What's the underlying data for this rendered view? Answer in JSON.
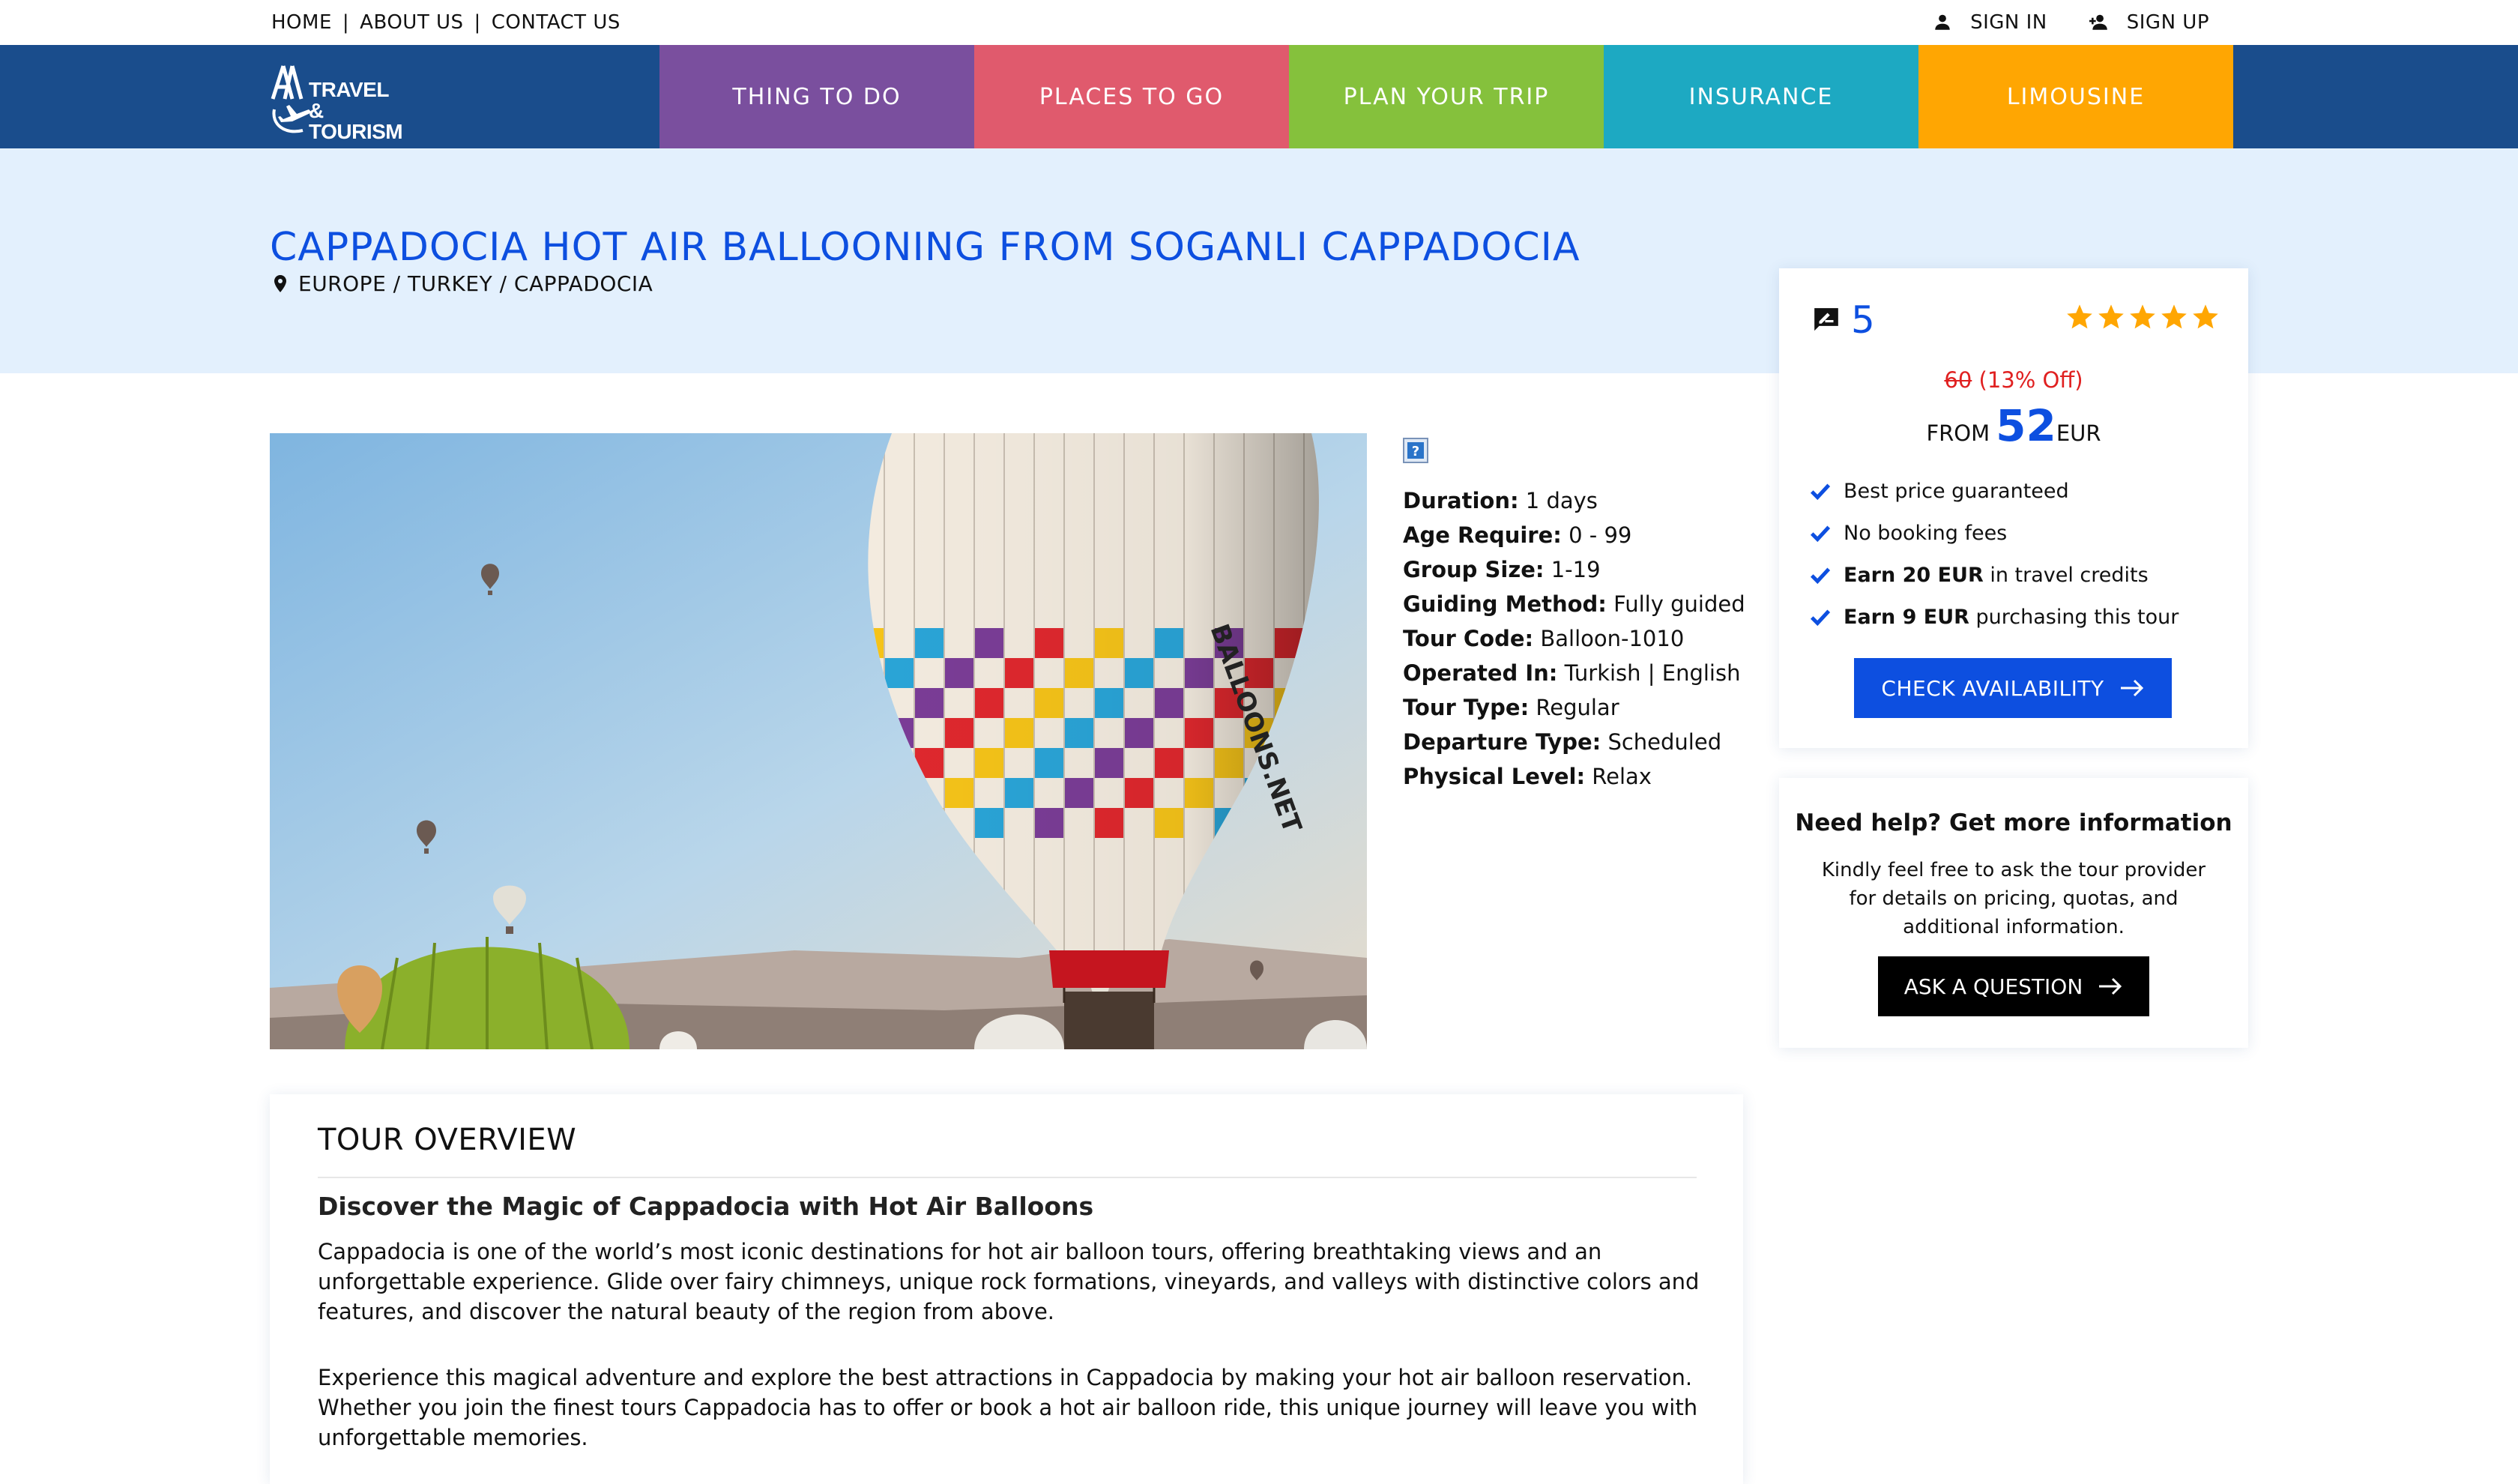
{
  "topbar": {
    "links": [
      "HOME",
      "ABOUT US",
      "CONTACT US"
    ],
    "sign_in": "SIGN IN",
    "sign_up": "SIGN UP"
  },
  "nav": {
    "logo_text": "TRAVEL & TOURISM",
    "logo_line1": "TRAVEL &",
    "logo_line2": "TOURISM",
    "items": [
      {
        "label": "THING TO DO",
        "color": "#7a4f9e"
      },
      {
        "label": "PLACES TO GO",
        "color": "#e05a6d"
      },
      {
        "label": "PLAN YOUR TRIP",
        "color": "#85c13c"
      },
      {
        "label": "INSURANCE",
        "color": "#1da9c2"
      },
      {
        "label": "LIMOUSINE",
        "color": "#ffa602"
      }
    ]
  },
  "hero": {
    "title": "CAPPADOCIA HOT AIR BALLOONING FROM SOGANLI CAPPADOCIA",
    "breadcrumb": "EUROPE / TURKEY / CAPPADOCIA"
  },
  "details": [
    {
      "label": "Duration:",
      "value": "1 days"
    },
    {
      "label": "Age Require:",
      "value": "0 - 99"
    },
    {
      "label": "Group Size:",
      "value": "1-19"
    },
    {
      "label": "Guiding Method:",
      "value": "Fully guided"
    },
    {
      "label": "Tour Code:",
      "value": "Balloon-1010"
    },
    {
      "label": "Operated In:",
      "value": "Turkish | English"
    },
    {
      "label": "Tour Type:",
      "value": "Regular"
    },
    {
      "label": "Departure Type:",
      "value": "Scheduled"
    },
    {
      "label": "Physical Level:",
      "value": "Relax"
    }
  ],
  "booking": {
    "review_count": "5",
    "stars": 5,
    "old_price": "60",
    "discount": "(13% Off)",
    "from_label": "FROM",
    "price": "52",
    "currency": "EUR",
    "features": [
      {
        "bold": "",
        "text": "Best price guaranteed"
      },
      {
        "bold": "",
        "text": "No booking fees"
      },
      {
        "bold": "Earn 20 EUR",
        "text": " in travel credits"
      },
      {
        "bold": "Earn 9 EUR",
        "text": " purchasing this tour"
      }
    ],
    "check_label": "CHECK AVAILABILITY"
  },
  "help": {
    "title": "Need help? Get more information",
    "text": "Kindly feel free to ask the tour provider for details on pricing, quotas, and additional information.",
    "button": "ASK A QUESTION"
  },
  "overview": {
    "title": "TOUR OVERVIEW",
    "subtitle": "Discover the Magic of Cappadocia with Hot Air Balloons",
    "paragraph1": "Cappadocia is one of the world’s most iconic destinations for hot air balloon tours, offering breathtaking views and an unforgettable experience. Glide over fairy chimneys, unique rock formations, vineyards, and valleys with distinctive colors and features, and discover the natural beauty of the region from above.",
    "paragraph2": "Experience this magical adventure and explore the best attractions in Cappadocia by making your hot air balloon reservation. Whether you join the finest tours Cappadocia has to offer or book a hot air balloon ride, this unique journey will leave you with unforgettable memories."
  },
  "colors": {
    "brand_blue": "#0d4fe0",
    "nav_bg": "#1a4d8c",
    "hero_bg": "#e3f0fd",
    "star": "#ffa602"
  }
}
